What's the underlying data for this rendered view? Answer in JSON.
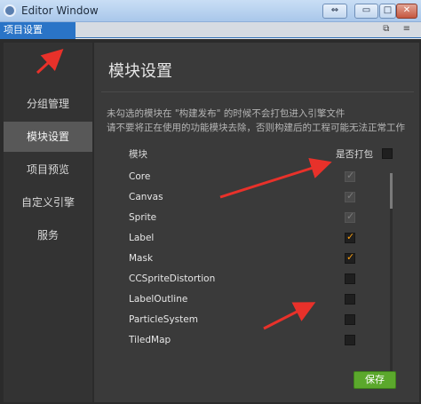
{
  "window": {
    "title": "Editor Window",
    "restore_glyph": "⇔",
    "minimize_glyph": "▭",
    "maximize_glyph": "□",
    "close_glyph": "✕"
  },
  "tab": {
    "label": "项目设置",
    "icons": "⧉ ≡"
  },
  "sidebar": {
    "items": [
      {
        "label": "分组管理",
        "active": false
      },
      {
        "label": "模块设置",
        "active": true
      },
      {
        "label": "项目预览",
        "active": false
      },
      {
        "label": "自定义引擎",
        "active": false
      },
      {
        "label": "服务",
        "active": false
      }
    ]
  },
  "main": {
    "title": "模块设置",
    "desc_line1": "未勾选的模块在 \"构建发布\" 的时候不会打包进入引擎文件",
    "desc_line2": "请不要将正在使用的功能模块去除，否则构建后的工程可能无法正常工作",
    "col_module": "模块",
    "col_pack": "是否打包",
    "modules": [
      {
        "name": "Core",
        "state": "disabled"
      },
      {
        "name": "Canvas",
        "state": "disabled"
      },
      {
        "name": "Sprite",
        "state": "disabled"
      },
      {
        "name": "Label",
        "state": "checked"
      },
      {
        "name": "Mask",
        "state": "checked"
      },
      {
        "name": "CCSpriteDistortion",
        "state": "unchecked"
      },
      {
        "name": "LabelOutline",
        "state": "unchecked"
      },
      {
        "name": "ParticleSystem",
        "state": "unchecked"
      },
      {
        "name": "TiledMap",
        "state": "unchecked"
      }
    ],
    "save_label": "保存"
  },
  "colors": {
    "accent_tab": "#2a74c7",
    "save_button": "#5ba82c",
    "check_orange": "#f39c12",
    "annotation_red": "#e8312a"
  }
}
